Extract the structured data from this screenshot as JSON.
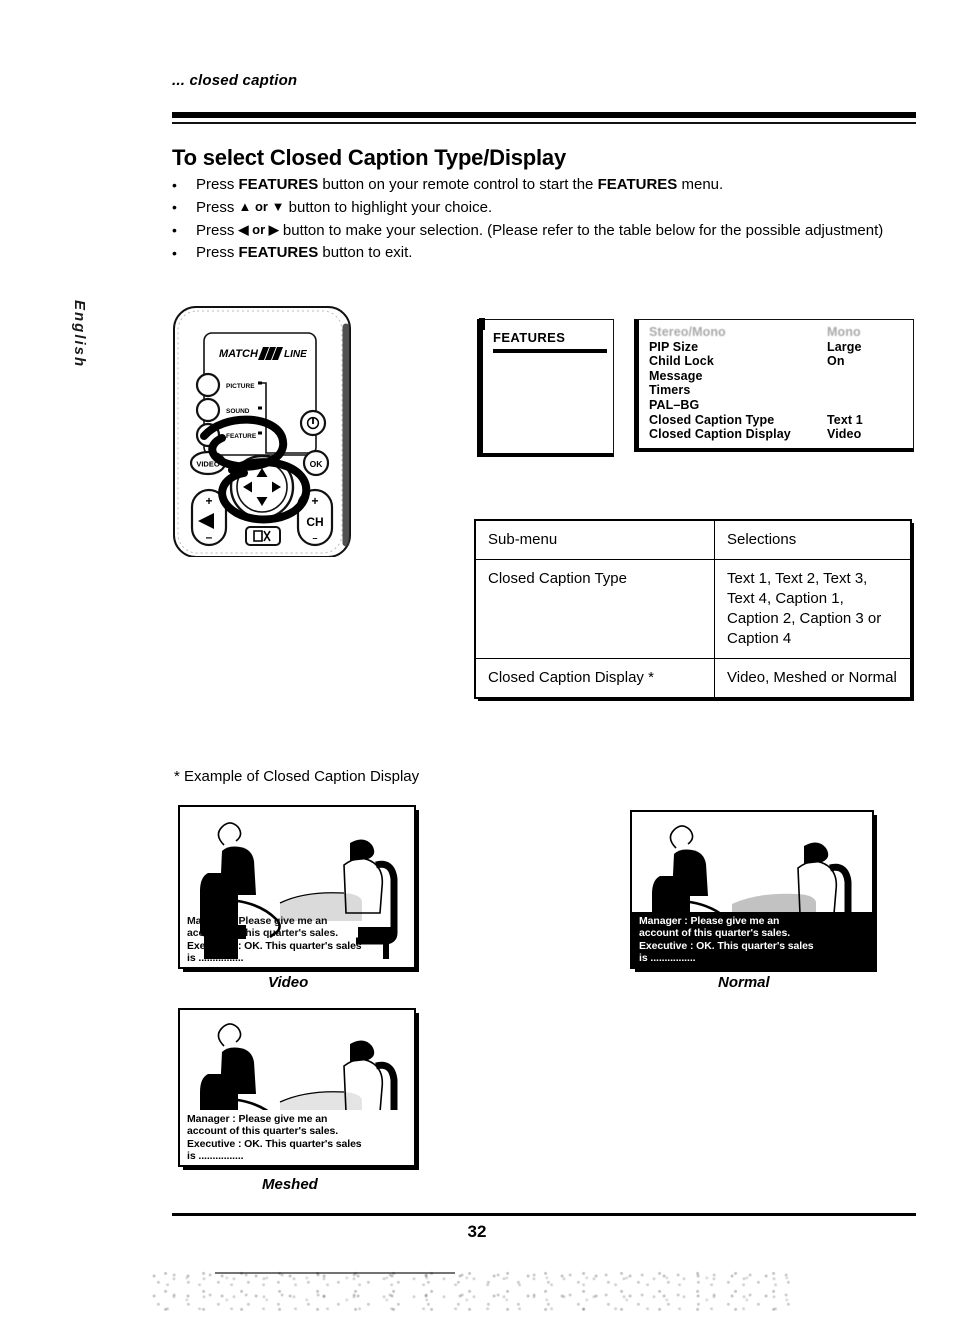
{
  "running_head": "... closed caption",
  "side_tab": "English",
  "heading": "To select Closed Caption Type/Display",
  "instructions": [
    {
      "pre": "Press ",
      "bold1": "FEATURES",
      "mid": " button on your remote control to start the ",
      "bold2": "FEATURES",
      "post": " menu."
    },
    {
      "pre": "Press ",
      "arrows": "▲ or ▼",
      "post": " button to highlight your choice."
    },
    {
      "pre": "Press ",
      "arrows": "◀ or ▶",
      "post": " button to make your selection. (Please refer to the table below for the possible adjustment)"
    },
    {
      "pre": "Press ",
      "bold1": "FEATURES",
      "post": " button to exit."
    }
  ],
  "remote": {
    "brand": "MATCH",
    "brand_suffix": "LINE",
    "buttons": [
      "PICTURE",
      "SOUND",
      "FEATURE",
      "VIDEO",
      "OK",
      "CH"
    ],
    "volume_plus": "+",
    "volume_minus": "–",
    "ch_label": "CH",
    "ch_plus": "+",
    "ch_minus": "–"
  },
  "osd": {
    "panel_title": "FEATURES",
    "rows": [
      {
        "label": "",
        "value": "",
        "ghost": true
      },
      {
        "label": "PIP Size",
        "value": "Large"
      },
      {
        "label": "Child Lock",
        "value": "On"
      },
      {
        "label": "Message",
        "value": ""
      },
      {
        "label": "Timers",
        "value": ""
      },
      {
        "label": "PAL–BG",
        "value": ""
      },
      {
        "label": "Closed Caption Type",
        "value": "Text 1"
      },
      {
        "label": "Closed Caption Display",
        "value": "Video"
      }
    ]
  },
  "table": {
    "headers": [
      "Sub-menu",
      "Selections"
    ],
    "rows": [
      [
        "Closed Caption Type",
        "Text 1, Text 2, Text 3, Text 4, Caption 1, Caption 2, Caption 3 or Caption 4"
      ],
      [
        "Closed Caption Display *",
        "Video, Meshed or Normal"
      ]
    ]
  },
  "examples": {
    "label": "* Example of Closed Caption Display",
    "caption_lines": [
      "Manager : Please give me an",
      "account of this quarter's sales.",
      "Executive : OK.  This quarter's sales",
      "is ................"
    ],
    "names": {
      "video": "Video",
      "normal": "Normal",
      "meshed": "Meshed"
    }
  },
  "page_number": "32"
}
